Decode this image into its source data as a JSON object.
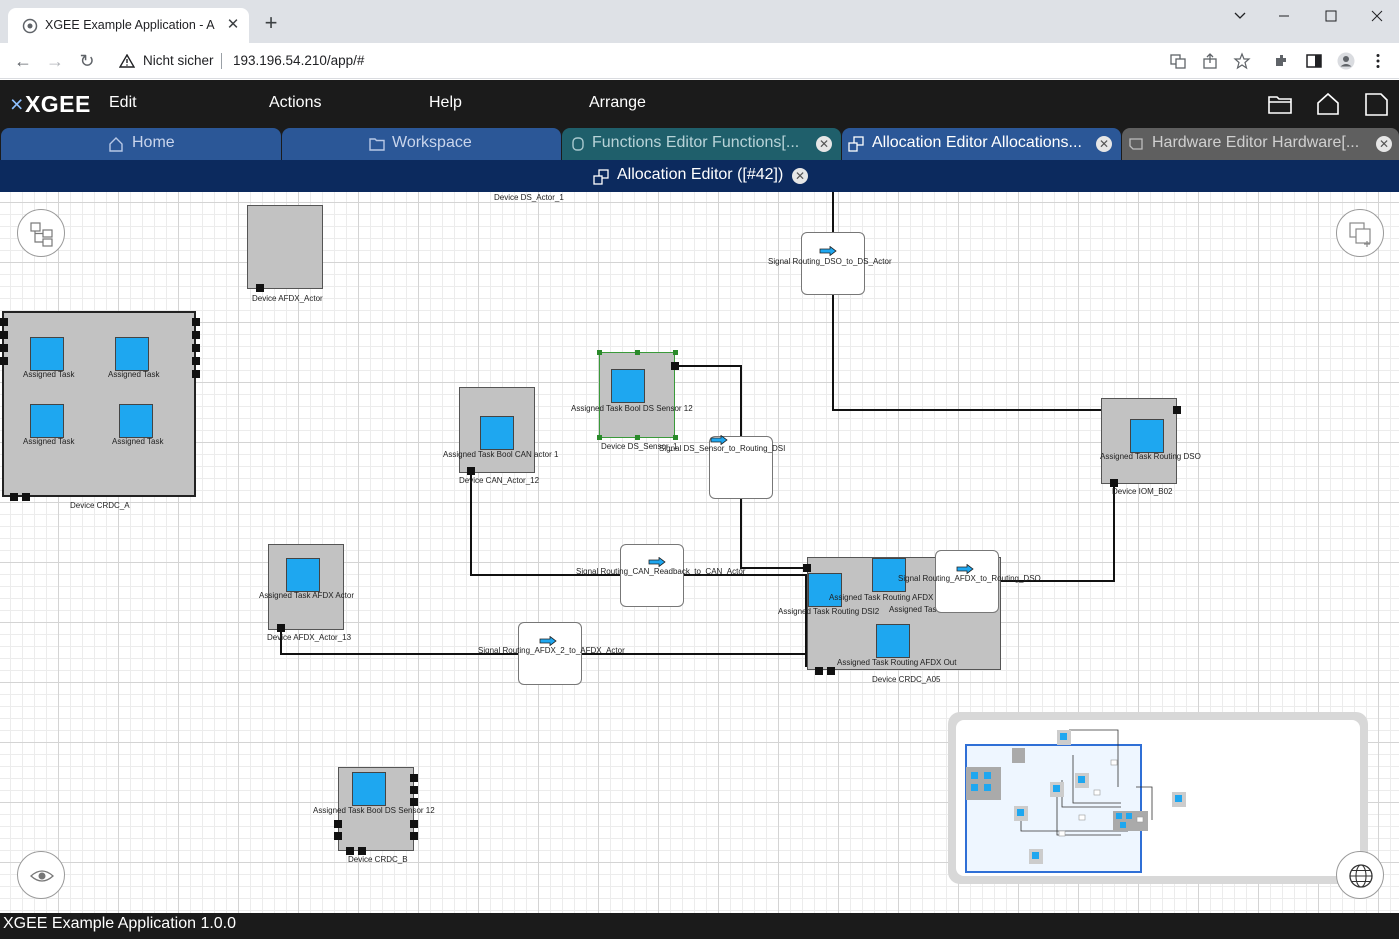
{
  "browser": {
    "tab_title": "XGEE Example Application - Alloc",
    "new_tab_icon": "plus-icon",
    "security_label": "Nicht sicher",
    "url": "193.196.54.210/app/#"
  },
  "app": {
    "logo_text": "XGEE",
    "menu": [
      "Edit",
      "Actions",
      "Help",
      "Arrange"
    ],
    "toolbar_icons": [
      "folder-icon",
      "home-icon",
      "new-document-icon"
    ]
  },
  "editor_tabs": [
    {
      "label": "Home",
      "icon": "home-icon",
      "closable": false
    },
    {
      "label": "Workspace",
      "icon": "folder-icon",
      "closable": false
    },
    {
      "label": "Functions Editor Functions[...",
      "icon": "functions-icon",
      "closable": true
    },
    {
      "label": "Allocation Editor Allocations...",
      "icon": "allocation-icon",
      "closable": true,
      "active": true
    },
    {
      "label": "Hardware Editor Hardware[...",
      "icon": "hardware-icon",
      "closable": true
    }
  ],
  "sub_header": {
    "label": "Allocation Editor ([#42])"
  },
  "diagram": {
    "devices": {
      "ds_actor": "Device DS_Actor_1",
      "afdx_actor": "Device AFDX_Actor",
      "crdc_a": "Device CRDC_A",
      "ds_sensor": "Device DS_Sensor_1",
      "can_actor": "Device CAN_Actor_12",
      "iom_b02": "Device IOM_B02",
      "afdx_actor_13": "Device AFDX_Actor_13",
      "crdc_a05": "Device CRDC_A05",
      "crdc_b": "Device CRDC_B"
    },
    "tasks": {
      "assigned_task": "Assigned Task",
      "bool_ds_sensor": "Assigned Task Bool DS Sensor 12",
      "bool_can_actor": "Assigned Task Bool CAN actor 1",
      "routing_dso": "Assigned Task Routing DSO",
      "afdx_actor": "Assigned Task AFDX Actor",
      "routing_afdx_in": "Assigned Task Routing AFDX C",
      "routing_dsi2": "Assigned Task Routing DSI2",
      "assigned_task_cut": "Assigned Tas",
      "routing_afdx_out": "Assigned Task Routing AFDX Out",
      "bool_ds_sensor_b": "Assigned Task Bool DS Sensor 12"
    },
    "signals": {
      "dso_to_ds_actor": "Signal Routing_DSO_to_DS_Actor",
      "ds_sensor_to_routing": "Signal DS_Sensor_to_Routing_DSI",
      "can_readback": "Signal Routing_CAN_Readback_to_CAN_Actor",
      "afdx_to_routing_dso": "Signal Routing_AFDX_to_Routing_DSO",
      "afdx2_to_afdx_actor": "Signal Routing_AFDX_2_to_AFDX_Actor"
    },
    "overlay_icons": [
      "tree-layout-icon",
      "copy-icon",
      "eye-icon",
      "globe-icon"
    ]
  },
  "footer": {
    "text": "XGEE Example Application 1.0.0"
  },
  "colors": {
    "app_bar": "#1b1b1b",
    "tab_blue": "#2b5797",
    "tab_teal": "#1f5f6b",
    "tab_gray": "#5f5f5f",
    "sub_bar": "#0c2a5e",
    "task": "#1ea7f0",
    "device": "#c2c2c2"
  }
}
